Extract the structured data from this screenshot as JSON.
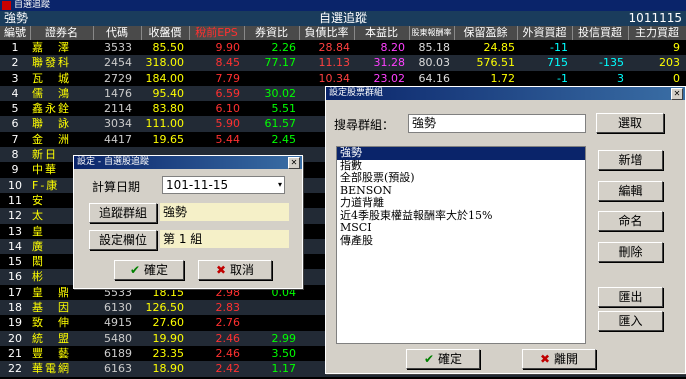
{
  "window": {
    "title": "自選追蹤"
  },
  "header": {
    "group": "強勢",
    "title": "自選追蹤",
    "time": "1011115"
  },
  "columns": [
    "編號",
    "證券名",
    "代碼",
    "收盤價",
    "稅前EPS",
    "券資比",
    "負債比率",
    "本益比",
    "股東報酬率",
    "保留盈餘",
    "外資買超",
    "投信買超",
    "主力買超"
  ],
  "rows": [
    {
      "num": "1",
      "name": "嘉　澤",
      "code": "3533",
      "price": "85.50",
      "eps": "9.90",
      "ratio": "2.26",
      "debt": "28.84",
      "pe": "8.20",
      "hold": "85.18",
      "margin": "24.85",
      "foreign": "-11",
      "trust": "",
      "main": "9"
    },
    {
      "num": "2",
      "name": "聯發科",
      "code": "2454",
      "price": "318.00",
      "eps": "8.45",
      "ratio": "77.17",
      "debt": "11.13",
      "pe": "31.28",
      "hold": "80.03",
      "margin": "576.51",
      "foreign": "715",
      "trust": "-135",
      "main": "203"
    },
    {
      "num": "3",
      "name": "瓦　城",
      "code": "2729",
      "price": "184.00",
      "eps": "7.79",
      "ratio": "",
      "debt": "10.34",
      "pe": "23.02",
      "hold": "64.16",
      "margin": "1.72",
      "foreign": "-1",
      "trust": "3",
      "main": "0"
    },
    {
      "num": "4",
      "name": "儒　鴻",
      "code": "1476",
      "price": "95.40",
      "eps": "6.59",
      "ratio": "30.02",
      "debt": "",
      "pe": "",
      "hold": "",
      "margin": "",
      "foreign": "",
      "trust": "",
      "main": ""
    },
    {
      "num": "5",
      "name": "鑫永銓",
      "code": "2114",
      "price": "83.80",
      "eps": "6.10",
      "ratio": "5.51",
      "debt": "",
      "pe": "",
      "hold": "",
      "margin": "",
      "foreign": "",
      "trust": "",
      "main": ""
    },
    {
      "num": "6",
      "name": "聯　詠",
      "code": "3034",
      "price": "111.00",
      "eps": "5.90",
      "ratio": "61.57",
      "debt": "",
      "pe": "",
      "hold": "",
      "margin": "",
      "foreign": "",
      "trust": "",
      "main": ""
    },
    {
      "num": "7",
      "name": "金　洲",
      "code": "4417",
      "price": "19.65",
      "eps": "5.44",
      "ratio": "2.45",
      "debt": "",
      "pe": "",
      "hold": "",
      "margin": "",
      "foreign": "",
      "trust": "",
      "main": ""
    },
    {
      "num": "8",
      "name": "新日",
      "code": "",
      "price": "",
      "eps": "",
      "ratio": "",
      "debt": "",
      "pe": "",
      "hold": "",
      "margin": "",
      "foreign": "",
      "trust": "",
      "main": ""
    },
    {
      "num": "9",
      "name": "中華",
      "code": "",
      "price": "",
      "eps": "",
      "ratio": "",
      "debt": "",
      "pe": "",
      "hold": "",
      "margin": "",
      "foreign": "",
      "trust": "",
      "main": ""
    },
    {
      "num": "10",
      "name": "F-康",
      "code": "",
      "price": "",
      "eps": "",
      "ratio": "",
      "debt": "",
      "pe": "",
      "hold": "",
      "margin": "",
      "foreign": "",
      "trust": "",
      "main": ""
    },
    {
      "num": "11",
      "name": "安",
      "code": "",
      "price": "",
      "eps": "",
      "ratio": "",
      "debt": "",
      "pe": "",
      "hold": "",
      "margin": "",
      "foreign": "",
      "trust": "",
      "main": ""
    },
    {
      "num": "12",
      "name": "太",
      "code": "",
      "price": "",
      "eps": "",
      "ratio": "",
      "debt": "",
      "pe": "",
      "hold": "",
      "margin": "",
      "foreign": "",
      "trust": "",
      "main": ""
    },
    {
      "num": "13",
      "name": "皇",
      "code": "",
      "price": "",
      "eps": "",
      "ratio": "",
      "debt": "",
      "pe": "",
      "hold": "",
      "margin": "",
      "foreign": "",
      "trust": "",
      "main": ""
    },
    {
      "num": "14",
      "name": "廣",
      "code": "",
      "price": "",
      "eps": "",
      "ratio": "",
      "debt": "",
      "pe": "",
      "hold": "",
      "margin": "",
      "foreign": "",
      "trust": "",
      "main": ""
    },
    {
      "num": "15",
      "name": "閎",
      "code": "",
      "price": "",
      "eps": "",
      "ratio": "",
      "debt": "",
      "pe": "",
      "hold": "",
      "margin": "",
      "foreign": "",
      "trust": "",
      "main": ""
    },
    {
      "num": "16",
      "name": "彬",
      "code": "",
      "price": "",
      "eps": "",
      "ratio": "",
      "debt": "",
      "pe": "",
      "hold": "",
      "margin": "",
      "foreign": "",
      "trust": "",
      "main": ""
    },
    {
      "num": "17",
      "name": "皇　鼎",
      "code": "5533",
      "price": "18.15",
      "eps": "2.98",
      "ratio": "0.04",
      "debt": "",
      "pe": "",
      "hold": "",
      "margin": "",
      "foreign": "",
      "trust": "",
      "main": ""
    },
    {
      "num": "18",
      "name": "基　因",
      "code": "6130",
      "price": "126.50",
      "eps": "2.83",
      "ratio": "",
      "debt": "",
      "pe": "",
      "hold": "",
      "margin": "",
      "foreign": "",
      "trust": "",
      "main": ""
    },
    {
      "num": "19",
      "name": "致　伸",
      "code": "4915",
      "price": "27.60",
      "eps": "2.76",
      "ratio": "",
      "debt": "",
      "pe": "",
      "hold": "",
      "margin": "",
      "foreign": "",
      "trust": "",
      "main": ""
    },
    {
      "num": "20",
      "name": "統　盟",
      "code": "5480",
      "price": "19.90",
      "eps": "2.46",
      "ratio": "2.99",
      "debt": "",
      "pe": "",
      "hold": "",
      "margin": "",
      "foreign": "",
      "trust": "",
      "main": ""
    },
    {
      "num": "21",
      "name": "豐　藝",
      "code": "6189",
      "price": "23.35",
      "eps": "2.46",
      "ratio": "3.50",
      "debt": "",
      "pe": "",
      "hold": "",
      "margin": "",
      "foreign": "",
      "trust": "",
      "main": ""
    },
    {
      "num": "22",
      "name": "華電網",
      "code": "6163",
      "price": "18.90",
      "eps": "2.42",
      "ratio": "1.17",
      "debt": "",
      "pe": "",
      "hold": "",
      "margin": "",
      "foreign": "",
      "trust": "",
      "main": ""
    }
  ],
  "dialog_track": {
    "title": "設定 - 自選股追蹤",
    "date_label": "計算日期",
    "date_value": "101-11-15",
    "group_button": "追蹤群組",
    "group_value": "強勢",
    "column_button": "設定欄位",
    "column_value": "第 1 組",
    "ok": "確定",
    "cancel": "取消"
  },
  "dialog_group": {
    "title": "設定股票群組",
    "search_label": "搜尋群組：",
    "search_value": "強勢",
    "select_button": "選取",
    "items": [
      "強勢",
      "指數",
      "全部股票(預設)",
      "BENSON",
      "力道背離",
      "近4季股東權益報酬率大於15%",
      "MSCI",
      "傳產股"
    ],
    "selected_index": 0,
    "add": "新增",
    "edit": "編輯",
    "rename": "命名",
    "delete": "刪除",
    "export": "匯出",
    "import": "匯入",
    "ok": "確定",
    "close": "離開"
  },
  "colors": {
    "accent": "#0a246a",
    "price": "#ffff00",
    "eps": "#ff3030",
    "ratio": "#00ff00"
  }
}
